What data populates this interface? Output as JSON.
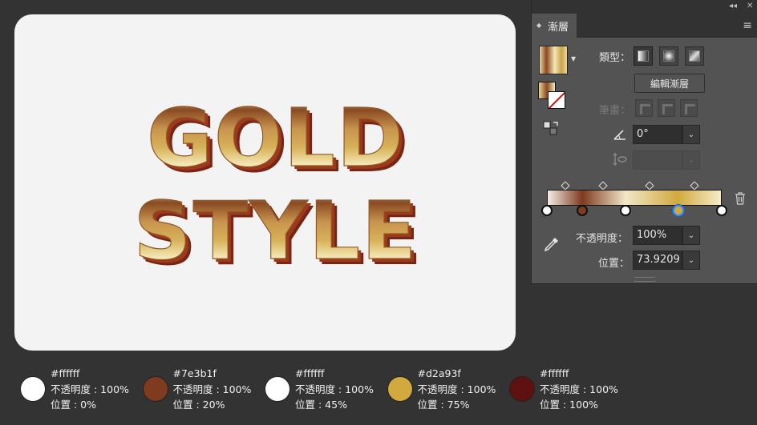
{
  "artboard": {
    "line1": "GOLD",
    "line2": "STYLE"
  },
  "panel": {
    "tab_label": "漸層",
    "type_label": "類型：",
    "edit_gradient_button": "編輯漸層",
    "stroke_label": "筆畫：",
    "angle_value": "0°",
    "opacity_label": "不透明度：",
    "opacity_value": "100%",
    "position_label": "位置：",
    "position_value": "73.9209",
    "stops": [
      {
        "color": "#ffffff",
        "position": 0
      },
      {
        "color": "#7e3b1f",
        "position": 20
      },
      {
        "color": "#ffffff",
        "position": 45
      },
      {
        "color": "#d2a93f",
        "position": 75,
        "selected": true
      },
      {
        "color": "#ffffff",
        "position": 100
      }
    ],
    "icons": [
      "collapse-icon",
      "close-icon",
      "panel-menu-icon",
      "swap-icon",
      "angle-icon",
      "aspect-ratio-icon",
      "trash-icon",
      "eyedropper-icon"
    ]
  },
  "legend": [
    {
      "hex": "#ffffff",
      "opacity": "不透明度 : 100%",
      "position": "位置 : 0%",
      "swatch": "#ffffff"
    },
    {
      "hex": "#7e3b1f",
      "opacity": "不透明度 : 100%",
      "position": "位置 : 20%",
      "swatch": "#7e3b1f"
    },
    {
      "hex": "#ffffff",
      "opacity": "不透明度 : 100%",
      "position": "位置 : 45%",
      "swatch": "#ffffff"
    },
    {
      "hex": "#d2a93f",
      "opacity": "不透明度 : 100%",
      "position": "位置 : 75%",
      "swatch": "#d2a93f"
    },
    {
      "hex": "#ffffff",
      "opacity": "不透明度 : 100%",
      "position": "位置 : 100%",
      "swatch": "#5f1010"
    }
  ]
}
